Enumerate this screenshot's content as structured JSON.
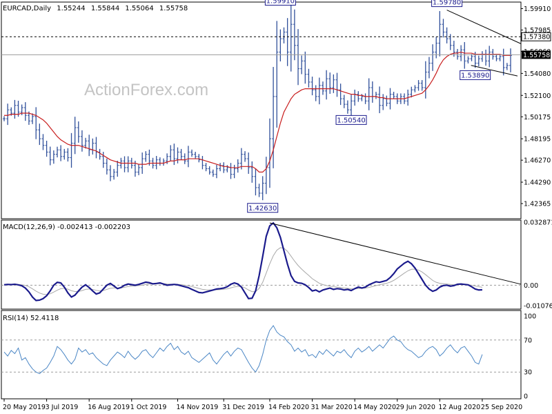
{
  "header": {
    "symbol": "EURCAD,Daily",
    "open": "1.55244",
    "high": "1.55844",
    "low": "1.55064",
    "close": "1.55758"
  },
  "watermark": "ActionForex.com",
  "colors": {
    "price_bars": "#2f4f9a",
    "moving_average": "#c81d1d",
    "macd_line": "#1a1a8c",
    "macd_signal": "#a8a8a8",
    "rsi_line": "#4a86c5",
    "trendline": "#000000",
    "callout_fill": "#ffffff",
    "callout_border": "#1a1a8c",
    "callout_text": "#1a1a8c",
    "current_price_fill": "#000000",
    "current_price_text": "#ffffff"
  },
  "chart_data": [
    {
      "type": "line",
      "panel": "price",
      "ylim": [
        1.41,
        1.605
      ],
      "y_ticks": [
        "1.59910",
        "1.57985",
        "1.56060",
        "1.54080",
        "1.52100",
        "1.50175",
        "1.48195",
        "1.46270",
        "1.44290",
        "1.42365"
      ],
      "x_ticks": [
        "20 May 2019",
        "3 Jul 2019",
        "16 Aug 2019",
        "1 Oct 2019",
        "14 Nov 2019",
        "31 Dec 2019",
        "14 Feb 2020",
        "31 Mar 2020",
        "14 May 2020",
        "29 Jun 2020",
        "12 Aug 2020",
        "25 Sep 2020"
      ],
      "series": [
        {
          "style": "hlc-bars",
          "values": [
            1.5,
            1.508,
            1.505,
            1.512,
            1.506,
            1.51,
            1.503,
            1.498,
            1.502,
            1.49,
            1.482,
            1.476,
            1.47,
            1.463,
            1.468,
            1.472,
            1.466,
            1.47,
            1.465,
            1.478,
            1.492,
            1.484,
            1.476,
            1.48,
            1.472,
            1.478,
            1.47,
            1.466,
            1.46,
            1.454,
            1.448,
            1.452,
            1.458,
            1.462,
            1.456,
            1.462,
            1.458,
            1.452,
            1.456,
            1.464,
            1.468,
            1.462,
            1.458,
            1.463,
            1.46,
            1.462,
            1.466,
            1.472,
            1.464,
            1.47,
            1.466,
            1.462,
            1.47,
            1.468,
            1.466,
            1.463,
            1.458,
            1.455,
            1.452,
            1.45,
            1.455,
            1.458,
            1.454,
            1.456,
            1.45,
            1.455,
            1.46,
            1.468,
            1.464,
            1.456,
            1.448,
            1.438,
            1.433,
            1.442,
            1.456,
            1.482,
            1.52,
            1.56,
            1.572,
            1.578,
            1.56,
            1.585,
            1.566,
            1.545,
            1.552,
            1.54,
            1.533,
            1.526,
            1.52,
            1.53,
            1.525,
            1.536,
            1.528,
            1.535,
            1.526,
            1.518,
            1.513,
            1.508,
            1.516,
            1.522,
            1.518,
            1.52,
            1.516,
            1.528,
            1.52,
            1.522,
            1.512,
            1.518,
            1.514,
            1.522,
            1.52,
            1.516,
            1.52,
            1.516,
            1.522,
            1.526,
            1.528,
            1.532,
            1.528,
            1.542,
            1.55,
            1.56,
            1.568,
            1.585,
            1.578,
            1.572,
            1.566,
            1.56,
            1.556,
            1.562,
            1.552,
            1.554,
            1.556,
            1.55,
            1.554,
            1.558,
            1.552,
            1.56,
            1.556,
            1.554,
            1.556,
            1.546,
            1.548,
            1.557
          ]
        },
        {
          "name": "moving average",
          "values": [
            1.503,
            1.503,
            1.504,
            1.504,
            1.504,
            1.505,
            1.505,
            1.505,
            1.504,
            1.503,
            1.501,
            1.499,
            1.496,
            1.492,
            1.488,
            1.484,
            1.481,
            1.479,
            1.477,
            1.476,
            1.476,
            1.476,
            1.475,
            1.474,
            1.473,
            1.472,
            1.471,
            1.469,
            1.467,
            1.465,
            1.463,
            1.462,
            1.461,
            1.46,
            1.46,
            1.46,
            1.46,
            1.46,
            1.459,
            1.459,
            1.459,
            1.46,
            1.46,
            1.46,
            1.46,
            1.46,
            1.461,
            1.462,
            1.462,
            1.463,
            1.463,
            1.463,
            1.464,
            1.464,
            1.464,
            1.464,
            1.463,
            1.462,
            1.461,
            1.46,
            1.459,
            1.458,
            1.457,
            1.457,
            1.456,
            1.456,
            1.456,
            1.457,
            1.457,
            1.457,
            1.457,
            1.455,
            1.452,
            1.452,
            1.455,
            1.462,
            1.472,
            1.484,
            1.496,
            1.506,
            1.512,
            1.518,
            1.522,
            1.524,
            1.526,
            1.527,
            1.527,
            1.527,
            1.527,
            1.527,
            1.527,
            1.527,
            1.527,
            1.527,
            1.526,
            1.525,
            1.524,
            1.523,
            1.522,
            1.522,
            1.521,
            1.521,
            1.52,
            1.52,
            1.52,
            1.52,
            1.519,
            1.519,
            1.518,
            1.518,
            1.518,
            1.518,
            1.518,
            1.518,
            1.519,
            1.52,
            1.521,
            1.522,
            1.523,
            1.526,
            1.53,
            1.535,
            1.541,
            1.548,
            1.553,
            1.556,
            1.558,
            1.559,
            1.559,
            1.56,
            1.559,
            1.559,
            1.559,
            1.558,
            1.558,
            1.558,
            1.558,
            1.558,
            1.558,
            1.558,
            1.558,
            1.557,
            1.557,
            1.557
          ]
        }
      ],
      "price_callouts": [
        "1.59910",
        "1.59780",
        "1.50540",
        "1.42630",
        "1.53890"
      ],
      "dashed_level": "1.57380",
      "current_price": "1.55758"
    },
    {
      "type": "line",
      "panel": "macd",
      "title": "MACD(12,26,9) -0.002413 -0.002203",
      "ylim": [
        -0.0125,
        0.034
      ],
      "y_ticks": [
        "0.032871",
        "0.00",
        "-0.010762"
      ],
      "series": [
        {
          "name": "MACD",
          "values": [
            0.0002,
            0.0004,
            0.0003,
            0.0005,
            0.0002,
            -0.0003,
            -0.0015,
            -0.0035,
            -0.0062,
            -0.008,
            -0.0078,
            -0.007,
            -0.0055,
            -0.003,
            0.0,
            0.0015,
            0.0012,
            -0.001,
            -0.004,
            -0.0062,
            -0.0052,
            -0.003,
            -0.001,
            0.0002,
            -0.0012,
            -0.003,
            -0.0046,
            -0.004,
            -0.002,
            0.0,
            0.0009,
            -0.0004,
            -0.0018,
            -0.0012,
            0.0,
            0.0006,
            0.0003,
            0.0,
            0.0004,
            0.001,
            0.0016,
            0.0013,
            0.0007,
            0.0009,
            0.0012,
            0.0006,
            0.0,
            0.0002,
            0.0004,
            0.0002,
            -0.0003,
            -0.0008,
            -0.0013,
            -0.0022,
            -0.003,
            -0.0038,
            -0.004,
            -0.0035,
            -0.003,
            -0.0025,
            -0.002,
            -0.0018,
            -0.0015,
            -0.0008,
            0.0005,
            0.0012,
            0.0006,
            -0.001,
            -0.004,
            -0.007,
            -0.0068,
            -0.003,
            0.005,
            0.015,
            0.0255,
            0.031,
            0.0325,
            0.03,
            0.025,
            0.018,
            0.011,
            0.005,
            0.002,
            0.0012,
            0.001,
            0.0002,
            -0.0012,
            -0.003,
            -0.0025,
            -0.0035,
            -0.0025,
            -0.002,
            -0.0015,
            -0.0022,
            -0.0018,
            -0.002,
            -0.0025,
            -0.0022,
            -0.0028,
            -0.0018,
            -0.001,
            -0.0015,
            -0.001,
            0.0002,
            0.001,
            0.0018,
            0.0015,
            0.002,
            0.0025,
            0.004,
            0.006,
            0.0085,
            0.01,
            0.0115,
            0.0125,
            0.0112,
            0.009,
            0.006,
            0.003,
            0.0,
            -0.002,
            -0.0032,
            -0.0025,
            -0.001,
            -0.0002,
            0.0,
            -0.0005,
            -0.0002,
            0.0005,
            0.0006,
            0.0004,
            0.0002,
            -0.0008,
            -0.002,
            -0.0025,
            -0.0024
          ]
        },
        {
          "name": "signal",
          "values": [
            0.0001,
            0.0002,
            0.0003,
            0.0003,
            0.0003,
            0.0002,
            -0.0001,
            -0.0008,
            -0.0019,
            -0.0031,
            -0.0041,
            -0.0047,
            -0.0049,
            -0.0045,
            -0.0036,
            -0.0026,
            -0.0018,
            -0.0016,
            -0.0021,
            -0.0029,
            -0.0033,
            -0.0033,
            -0.0028,
            -0.0022,
            -0.002,
            -0.0022,
            -0.0027,
            -0.003,
            -0.0028,
            -0.0022,
            -0.0016,
            -0.0014,
            -0.0015,
            -0.0014,
            -0.0011,
            -0.0007,
            -0.0005,
            -0.0004,
            -0.0002,
            0.0,
            0.0004,
            0.0006,
            0.0006,
            0.0007,
            0.0008,
            0.0008,
            0.0006,
            0.0005,
            0.0005,
            0.0004,
            0.0003,
            0.0,
            -0.0003,
            -0.0007,
            -0.0012,
            -0.0017,
            -0.0022,
            -0.0024,
            -0.0025,
            -0.0025,
            -0.0024,
            -0.0023,
            -0.0021,
            -0.0019,
            -0.0014,
            -0.0009,
            -0.0006,
            -0.0007,
            -0.0014,
            -0.0025,
            -0.0034,
            -0.0033,
            -0.0017,
            0.0015,
            0.0063,
            0.0112,
            0.0154,
            0.0183,
            0.0196,
            0.0193,
            0.0177,
            0.0152,
            0.0126,
            0.0103,
            0.0084,
            0.0067,
            0.0051,
            0.0034,
            0.0022,
            0.001,
            0.0003,
            -0.0002,
            -0.0005,
            -0.0008,
            -0.001,
            -0.0012,
            -0.0015,
            -0.0016,
            -0.0019,
            -0.0019,
            -0.0017,
            -0.0016,
            -0.0015,
            -0.0012,
            -0.0007,
            -0.0002,
            0.0002,
            0.0006,
            0.001,
            0.0016,
            0.0025,
            0.0037,
            0.005,
            0.0063,
            0.0075,
            0.0083,
            0.0084,
            0.0079,
            0.0069,
            0.0055,
            0.004,
            0.0025,
            0.0015,
            0.001,
            0.0008,
            0.0006,
            0.0004,
            0.0002,
            0.0003,
            0.0003,
            0.0003,
            0.0003,
            0.0,
            -0.0004,
            -0.0008,
            -0.0011
          ]
        }
      ]
    },
    {
      "type": "line",
      "panel": "rsi",
      "title": "RSI(14) 52.4118",
      "ylim": [
        0,
        100
      ],
      "y_ticks": [
        "100",
        "70",
        "30",
        "0"
      ],
      "series": [
        {
          "name": "RSI",
          "values": [
            55,
            50,
            57,
            53,
            60,
            45,
            48,
            40,
            34,
            30,
            28,
            32,
            35,
            42,
            50,
            62,
            58,
            52,
            45,
            40,
            46,
            60,
            55,
            58,
            52,
            54,
            48,
            44,
            40,
            38,
            45,
            50,
            55,
            52,
            48,
            56,
            50,
            46,
            50,
            56,
            58,
            52,
            48,
            54,
            60,
            56,
            62,
            66,
            58,
            62,
            55,
            52,
            56,
            48,
            45,
            42,
            46,
            50,
            54,
            45,
            40,
            46,
            52,
            56,
            50,
            56,
            60,
            58,
            50,
            42,
            35,
            30,
            38,
            52,
            70,
            82,
            88,
            80,
            76,
            74,
            68,
            64,
            56,
            60,
            55,
            58,
            50,
            52,
            48,
            56,
            52,
            58,
            54,
            50,
            56,
            54,
            58,
            52,
            48,
            56,
            60,
            55,
            58,
            62,
            56,
            60,
            64,
            60,
            66,
            72,
            75,
            70,
            68,
            62,
            58,
            56,
            52,
            48,
            50,
            56,
            60,
            62,
            58,
            50,
            54,
            60,
            64,
            58,
            54,
            60,
            62,
            56,
            50,
            42,
            40,
            52
          ]
        }
      ]
    }
  ]
}
